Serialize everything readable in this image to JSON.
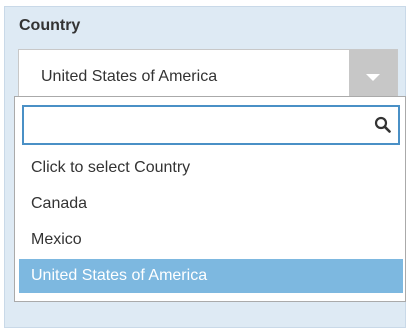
{
  "field": {
    "label": "Country",
    "selected_value": "United States of America"
  },
  "dropdown": {
    "search": {
      "value": "",
      "placeholder": ""
    },
    "hint": "Click to select Country",
    "options": [
      {
        "label": "Canada",
        "selected": false
      },
      {
        "label": "Mexico",
        "selected": false
      },
      {
        "label": "United States of America",
        "selected": true
      }
    ]
  },
  "icons": {
    "search": "search-icon",
    "arrow": "chevron-down-icon"
  },
  "colors": {
    "panel_bg": "#deeaf4",
    "highlight": "#7db8e0",
    "focus_border": "#4a90c6",
    "arrow_bg": "#c7c7c7"
  }
}
